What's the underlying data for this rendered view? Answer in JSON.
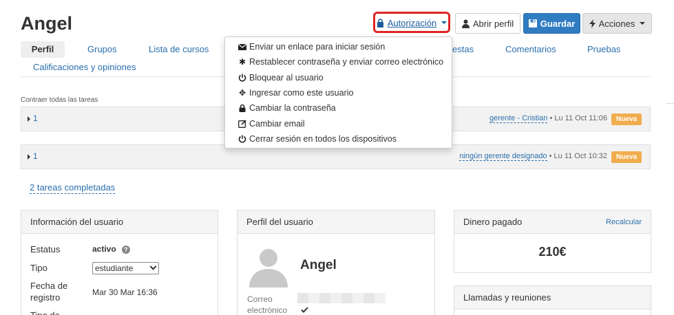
{
  "user": {
    "name": "Angel"
  },
  "toolbar": {
    "auth_label": "Autorización",
    "open_profile_label": "Abrir perfil",
    "save_label": "Guardar",
    "actions_label": "Acciones"
  },
  "tabs": [
    {
      "label": "Perfil"
    },
    {
      "label": "Grupos"
    },
    {
      "label": "Lista de cursos"
    },
    {
      "label": "estas"
    },
    {
      "label": "Comentarios"
    },
    {
      "label": "Pruebas"
    },
    {
      "label": "Calificaciones y opiniones"
    }
  ],
  "tasks": {
    "collapse_all": "Contraer todas las tareas",
    "rows": [
      {
        "number": "1",
        "manager": "gerente - Cristian",
        "date": " • Lu 11 Oct 11:06",
        "badge": "Nueva"
      },
      {
        "number": "1",
        "manager": "ningún gerente designado",
        "date": " • Lu 11 Oct 10:32",
        "badge": "Nueva"
      }
    ],
    "completed_link": "2 tareas completadas"
  },
  "user_info": {
    "title": "Información del usuario",
    "status_label": "Estatus",
    "status_value": "activo",
    "type_label": "Tipo",
    "type_value": "estudiante",
    "registration_label_1": "Fecha de",
    "registration_label_2": "registro",
    "registration_value": "Mar 30 Mar 16:36",
    "next_label": "Tipo de"
  },
  "user_profile": {
    "title": "Perfil del usuario",
    "name": "Angel",
    "email_label_1": "Correo",
    "email_label_2": "electrónico"
  },
  "money": {
    "title": "Dinero pagado",
    "recalc_label": "Recalcular",
    "amount": "210€"
  },
  "calls": {
    "title": "Llamadas y reuniones"
  },
  "auth_menu": [
    {
      "icon": "envelope-icon",
      "label": "Enviar un enlace para iniciar sesión"
    },
    {
      "icon": "asterisk-icon",
      "label": "Restablecer contraseña y enviar correo electrónico"
    },
    {
      "icon": "power-icon",
      "label": "Bloquear al usuario"
    },
    {
      "icon": "move-icon",
      "label": "Ingresar como este usuario"
    },
    {
      "icon": "lock-icon",
      "label": "Cambiar la contraseña"
    },
    {
      "icon": "edit-icon",
      "label": "Cambiar email"
    },
    {
      "icon": "power-icon",
      "label": "Cerrar sesión en todos los dispositivos"
    }
  ],
  "colors": {
    "link": "#2a6fad",
    "save_button": "#2f7cc1",
    "badge": "#f0ad4e",
    "highlight": "#e02424"
  }
}
